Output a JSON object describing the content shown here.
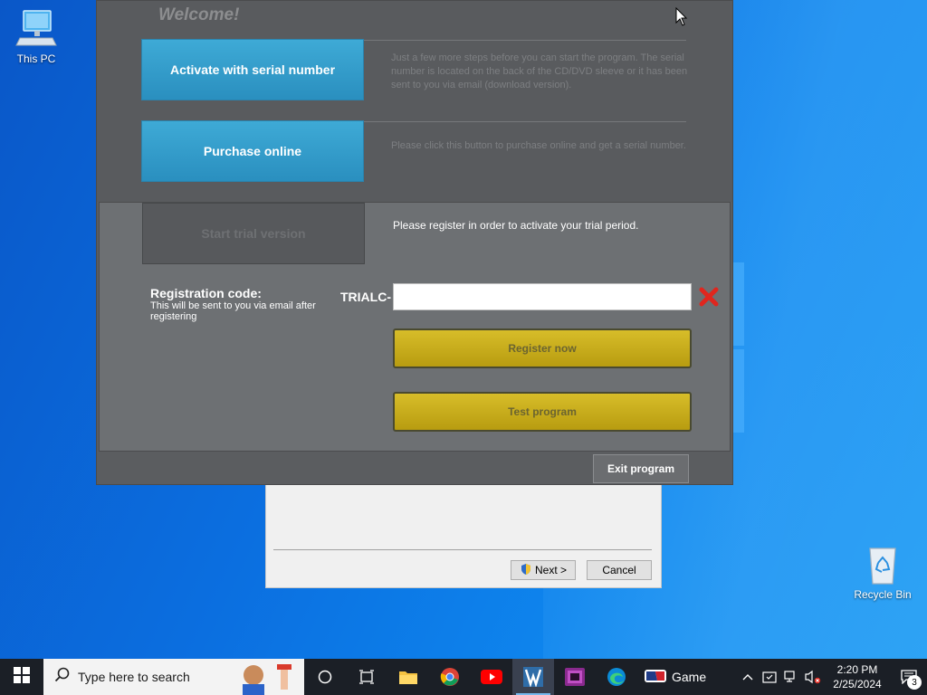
{
  "desktop": {
    "this_pc_label": "This PC",
    "recycle_bin_label": "Recycle Bin",
    "accent": "#0b6fe0"
  },
  "dialog": {
    "welcome": "Welcome!",
    "activate_label": "Activate with serial number",
    "activate_desc": "Just a few more steps before you can start the program. The serial number is located on the back of the CD/DVD sleeve or it has been sent to you via email (download version).",
    "purchase_label": "Purchase online",
    "purchase_desc": "Please click this button to purchase online and get a serial number.",
    "trial_label": "Start trial version",
    "register_info": "Please register in order to activate your trial period.",
    "reg_code_title": "Registration code:",
    "reg_code_sub": "This will be sent to you via email after registering",
    "code_prefix": "TRIALC-",
    "code_value": "",
    "register_label": "Register now",
    "test_label": "Test program",
    "exit_label": "Exit program",
    "blue": "#2f9acb",
    "gold": "#c8ad1c"
  },
  "installer": {
    "next_label": "Next >",
    "cancel_label": "Cancel"
  },
  "taskbar": {
    "search_placeholder": "Type here to search",
    "game_label": "Game",
    "time": "2:20 PM",
    "date": "2/25/2024",
    "notification_count": "3"
  }
}
